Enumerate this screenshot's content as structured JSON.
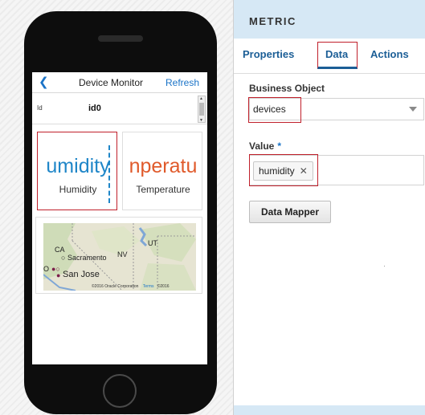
{
  "phone": {
    "header": {
      "back_icon": "chevron-left-icon",
      "title": "Device Monitor",
      "refresh_label": "Refresh"
    },
    "field": {
      "label": "Id",
      "value": "id0"
    },
    "metrics": [
      {
        "big_text": "umidity",
        "label": "Humidity",
        "color": "#1f86c8",
        "selected": true
      },
      {
        "big_text": "nperatu",
        "label": "Temperature",
        "color": "#e05a2b",
        "selected": false
      }
    ],
    "map": {
      "labels": {
        "ca": "CA",
        "nv": "NV",
        "ut": "UT",
        "sacramento": "Sacramento",
        "san_jose": "San Jose",
        "o": "O"
      },
      "copyright": "©2016 Oracle Corporation",
      "terms": "Terms",
      "copyright_year": "©2016"
    }
  },
  "panel": {
    "title": "METRIC",
    "tabs": [
      {
        "label": "Properties",
        "active": false
      },
      {
        "label": "Data",
        "active": true
      },
      {
        "label": "Actions",
        "active": false
      }
    ],
    "business_object": {
      "label": "Business Object",
      "value": "devices"
    },
    "value_field": {
      "label": "Value",
      "required_mark": "*",
      "tag": "humidity",
      "tag_remove_icon": "close-icon"
    },
    "data_mapper_label": "Data Mapper"
  },
  "colors": {
    "accent": "#1b5e96",
    "highlight": "#c0202b",
    "header_bg": "#d6e8f5"
  }
}
